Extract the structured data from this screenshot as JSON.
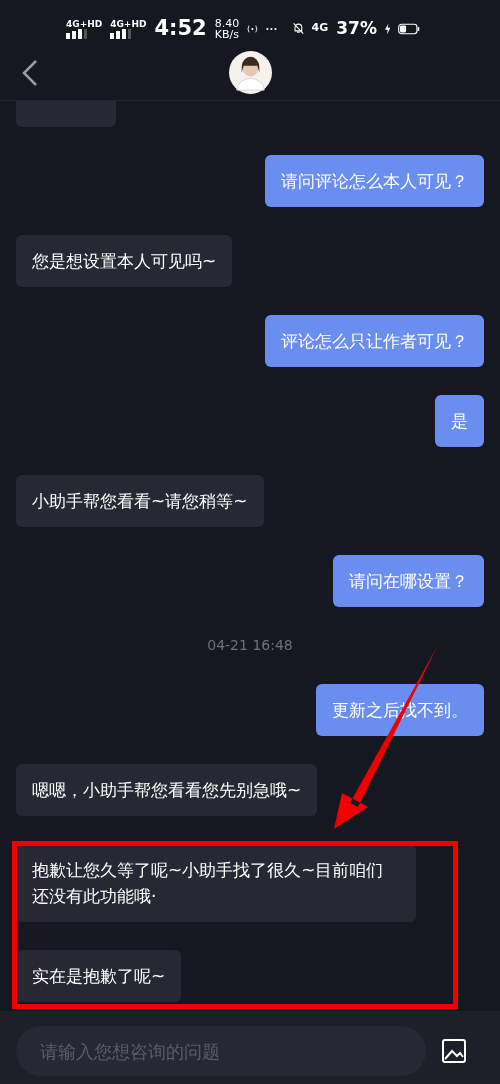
{
  "status_bar": {
    "network_1": "4G+HD",
    "network_2": "4G+HD",
    "time": "4:52",
    "speed_value": "8.40",
    "speed_unit": "KB/s",
    "mobile_data": "4G",
    "battery": "37%"
  },
  "messages": [
    {
      "kind": "incoming"
    },
    {
      "kind": "outgoing",
      "text": "请问评论怎么本人可见？"
    },
    {
      "kind": "incoming",
      "text": "您是想设置本人可见吗~"
    },
    {
      "kind": "outgoing",
      "text": "评论怎么只让作者可见？"
    },
    {
      "kind": "outgoing",
      "text": "是"
    },
    {
      "kind": "incoming",
      "text": "小助手帮您看看~请您稍等~"
    },
    {
      "kind": "outgoing",
      "text": "请问在哪设置？"
    },
    {
      "kind": "timestamp",
      "text": "04-21 16:48"
    },
    {
      "kind": "outgoing",
      "text": "更新之后找不到。"
    },
    {
      "kind": "incoming",
      "text": "嗯嗯，小助手帮您看看您先别急哦~"
    },
    {
      "kind": "incoming",
      "text": "抱歉让您久等了呢~小助手找了很久~目前咱们还没有此功能哦·"
    },
    {
      "kind": "incoming",
      "text": "实在是抱歉了呢~"
    }
  ],
  "input": {
    "placeholder": "请输入您想咨询的问题"
  }
}
